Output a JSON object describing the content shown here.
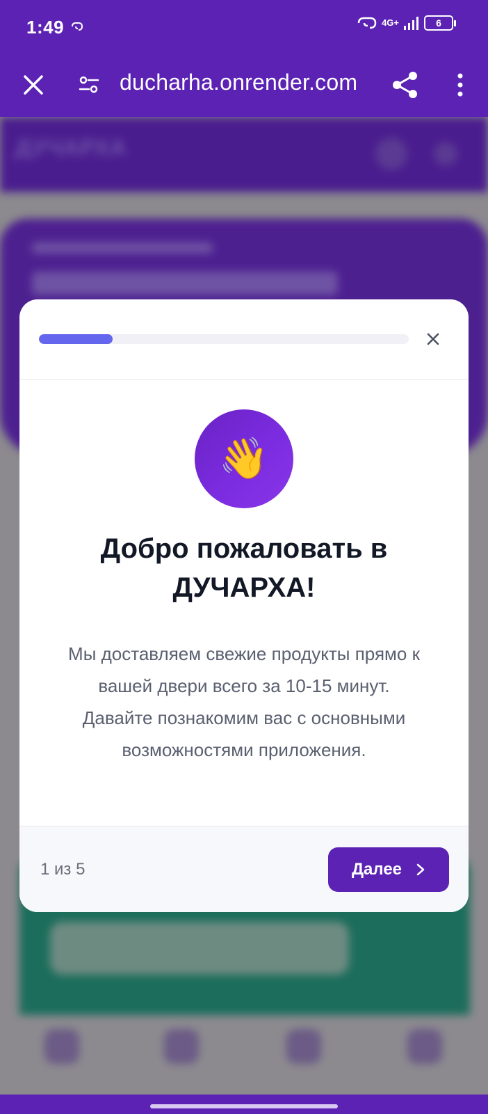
{
  "status_bar": {
    "time": "1:49",
    "network": "4G+",
    "battery": "6"
  },
  "browser": {
    "url": "ducharha.onrender.com"
  },
  "background_app": {
    "brand": "ДУЧАРХА"
  },
  "modal": {
    "progress_fraction": 0.2,
    "title_line1": "Добро пожаловать в",
    "title_line2": "ДУЧАРХА!",
    "hero_emoji": "👋",
    "description": "Мы доставляем свежие продукты прямо к вашей двери всего за 10-15 минут. Давайте познакомим вас с основными возможностями приложения.",
    "step_indicator": "1 из 5",
    "next_label": "Далее"
  },
  "colors": {
    "brand_purple": "#5b22b4",
    "progress": "#6466ee",
    "title_text": "#121826",
    "body_text": "#5b6070"
  }
}
